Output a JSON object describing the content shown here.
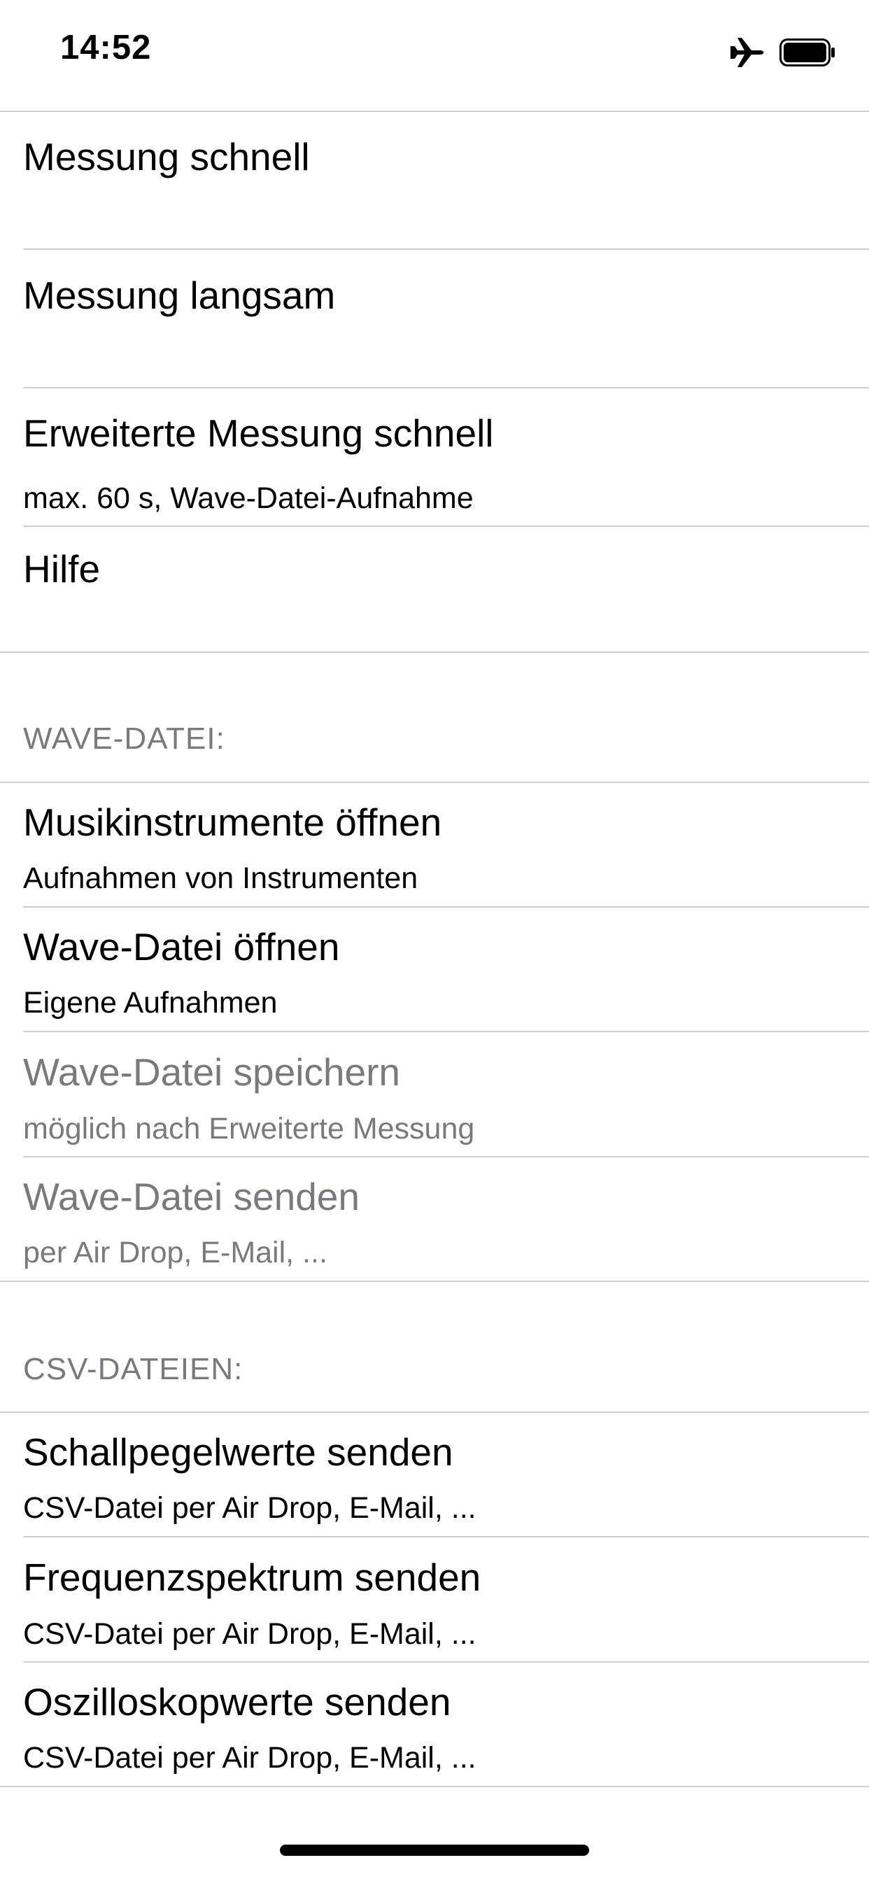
{
  "status_bar": {
    "time": "14:52",
    "icons": [
      "airplane-icon",
      "battery-icon"
    ]
  },
  "menu": {
    "items": [
      {
        "title": "Messung schnell",
        "subtitle": ""
      },
      {
        "title": "Messung langsam",
        "subtitle": ""
      },
      {
        "title": "Erweiterte Messung schnell",
        "subtitle": "max. 60 s, Wave-Datei-Aufnahme"
      },
      {
        "title": "Hilfe",
        "subtitle": ""
      }
    ]
  },
  "wave_section": {
    "header": "WAVE-DATEI:",
    "items": [
      {
        "title": "Musikinstrumente öffnen",
        "subtitle": "Aufnahmen von Instrumenten",
        "enabled": true
      },
      {
        "title": "Wave-Datei öffnen",
        "subtitle": "Eigene Aufnahmen",
        "enabled": true
      },
      {
        "title": "Wave-Datei speichern",
        "subtitle": "möglich nach Erweiterte Messung",
        "enabled": false
      },
      {
        "title": "Wave-Datei senden",
        "subtitle": "per Air Drop, E-Mail, ...",
        "enabled": false
      }
    ]
  },
  "csv_section": {
    "header": "CSV-DATEIEN:",
    "items": [
      {
        "title": "Schallpegelwerte senden",
        "subtitle": "CSV-Datei per Air Drop, E-Mail, ...",
        "enabled": true
      },
      {
        "title": "Frequenzspektrum senden",
        "subtitle": "CSV-Datei per Air Drop, E-Mail, ...",
        "enabled": true
      },
      {
        "title": "Oszilloskopwerte senden",
        "subtitle": "CSV-Datei per Air Drop, E-Mail, ...",
        "enabled": true
      }
    ]
  },
  "colors": {
    "text": "#000000",
    "disabled_text": "#7a7a7e",
    "separator": "#cfcfd2",
    "background": "#ffffff"
  }
}
